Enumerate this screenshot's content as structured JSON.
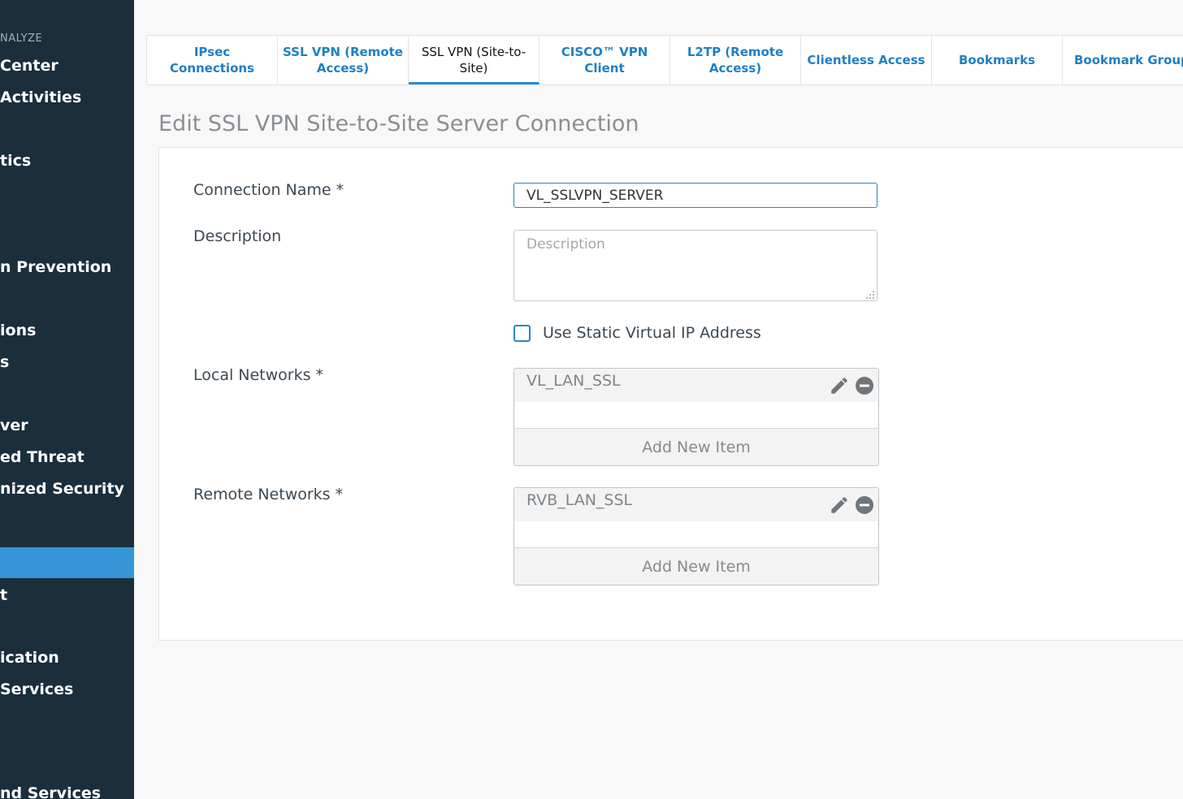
{
  "sidebar": {
    "section": "NALYZE",
    "items": [
      {
        "label": "Center",
        "active": false
      },
      {
        "label": "Activities",
        "active": false
      },
      {
        "label": "tics",
        "active": false
      },
      {
        "label": "n Prevention",
        "active": false
      },
      {
        "label": "ions",
        "active": false
      },
      {
        "label": "s",
        "active": false
      },
      {
        "label": "ver",
        "active": false
      },
      {
        "label": "ed Threat",
        "active": false
      },
      {
        "label": "nized Security",
        "active": false
      },
      {
        "label": "",
        "active": true
      },
      {
        "label": "t",
        "active": false
      },
      {
        "label": "ication",
        "active": false
      },
      {
        "label": "Services",
        "active": false
      },
      {
        "label": "nd Services",
        "active": false
      }
    ]
  },
  "tabs": [
    {
      "label": "IPsec Connections",
      "active": false
    },
    {
      "label": "SSL VPN (Remote Access)",
      "active": false
    },
    {
      "label": "SSL VPN (Site-to-Site)",
      "active": true
    },
    {
      "label": "CISCO™ VPN Client",
      "active": false
    },
    {
      "label": "L2TP (Remote Access)",
      "active": false
    },
    {
      "label": "Clientless Access",
      "active": false
    },
    {
      "label": "Bookmarks",
      "active": false
    },
    {
      "label": "Bookmark Groups",
      "active": false
    }
  ],
  "page_title": "Edit SSL VPN Site-to-Site Server Connection",
  "form": {
    "connection_name_label": "Connection Name *",
    "connection_name_value": "VL_SSLVPN_SERVER",
    "description_label": "Description",
    "description_placeholder": "Description",
    "static_ip_label": "Use Static Virtual IP Address",
    "static_ip_checked": false,
    "local_networks_label": "Local Networks *",
    "local_networks": [
      "VL_LAN_SSL"
    ],
    "remote_networks_label": "Remote Networks *",
    "remote_networks": [
      "RVB_LAN_SSL"
    ],
    "add_new_item_label": "Add New Item"
  },
  "colors": {
    "sidebar_bg": "#1b2e3c",
    "accent": "#3595d7",
    "link": "#1f7fc4"
  }
}
